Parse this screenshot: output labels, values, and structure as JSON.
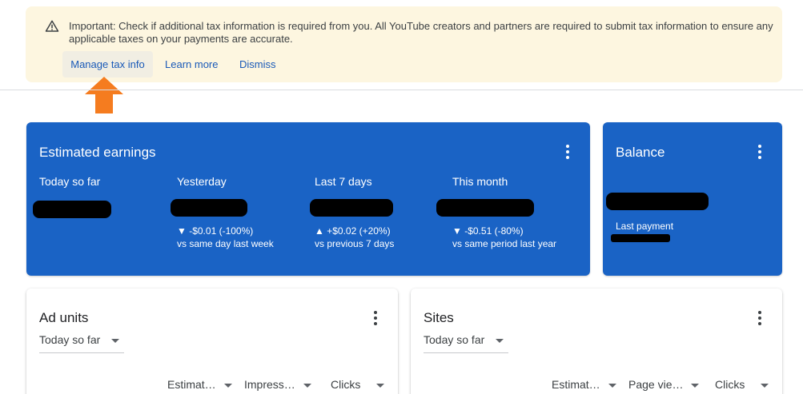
{
  "banner": {
    "message": "Important: Check if additional tax information is required from you. All YouTube creators and partners are required to submit tax information to ensure any applicable taxes on your payments are accurate.",
    "manage_label": "Manage tax info",
    "learn_label": "Learn more",
    "dismiss_label": "Dismiss"
  },
  "earnings": {
    "title": "Estimated earnings",
    "metrics": [
      {
        "label": "Today so far",
        "change": "",
        "comparison": ""
      },
      {
        "label": "Yesterday",
        "change": "▼ -$0.01 (-100%)",
        "comparison": "vs same day last week"
      },
      {
        "label": "Last 7 days",
        "change": "▲ +$0.02 (+20%)",
        "comparison": "vs previous 7 days"
      },
      {
        "label": "This month",
        "change": "▼ -$0.51 (-80%)",
        "comparison": "vs same period last year"
      }
    ]
  },
  "balance": {
    "title": "Balance",
    "last_payment_label": "Last payment"
  },
  "ad_units": {
    "title": "Ad units",
    "range": "Today so far",
    "columns": [
      "Estimat…",
      "Impress…",
      "Clicks"
    ]
  },
  "sites": {
    "title": "Sites",
    "range": "Today so far",
    "columns": [
      "Estimat…",
      "Page vie…",
      "Clicks"
    ]
  },
  "colors": {
    "accent": "#1a63c5",
    "banner_bg": "#fdf6e0",
    "link": "#1a5ab8",
    "pointer_arrow": "#f57c1f"
  },
  "icons": [
    "warning-icon",
    "more-vert-icon",
    "arrow-up-icon",
    "caret-down-icon"
  ]
}
